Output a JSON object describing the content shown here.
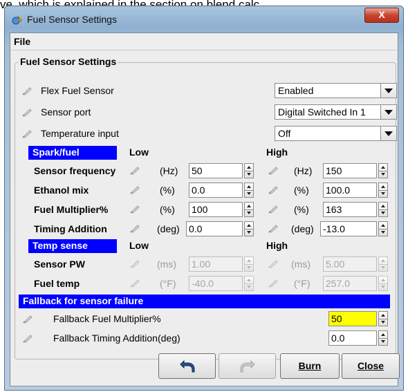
{
  "background_text": "ve, which is explained in the section on blend calc",
  "window": {
    "title": "Fuel Sensor Settings",
    "close_glyph": "X",
    "menu_file": "File"
  },
  "group": {
    "title": "Fuel Sensor Settings"
  },
  "settings": [
    {
      "label": "Flex Fuel Sensor",
      "value": "Enabled"
    },
    {
      "label": "Sensor port",
      "value": "Digital Switched In 1"
    },
    {
      "label": "Temperature input",
      "value": "Off"
    }
  ],
  "spark_fuel": {
    "header": "Spark/fuel",
    "low": "Low",
    "high": "High",
    "rows": [
      {
        "label": "Sensor frequency",
        "low_unit": "(Hz)",
        "low_value": "50",
        "high_unit": "(Hz)",
        "high_value": "150"
      },
      {
        "label": "Ethanol mix",
        "low_unit": "(%)",
        "low_value": "0.0",
        "high_unit": "(%)",
        "high_value": "100.0"
      },
      {
        "label": "Fuel Multiplier%",
        "low_unit": "(%)",
        "low_value": "100",
        "high_unit": "(%)",
        "high_value": "163"
      },
      {
        "label": "Timing Addition",
        "low_unit": "(deg)",
        "low_value": "0.0",
        "high_unit": "(deg)",
        "high_value": "-13.0"
      }
    ]
  },
  "temp_sense": {
    "header": "Temp sense",
    "low": "Low",
    "high": "High",
    "rows": [
      {
        "label": "Sensor PW",
        "low_unit": "(ms)",
        "low_value": "1.00",
        "high_unit": "(ms)",
        "high_value": "5.00"
      },
      {
        "label": "Fuel temp",
        "low_unit": "(°F)",
        "low_value": "-40.0",
        "high_unit": "(°F)",
        "high_value": "257.0"
      }
    ]
  },
  "fallback": {
    "header": "Fallback for sensor failure",
    "rows": [
      {
        "label": "Fallback Fuel Multiplier%",
        "value": "50"
      },
      {
        "label": "Fallback Timing Addition(deg)",
        "value": "0.0"
      }
    ]
  },
  "buttons": {
    "undo": "undo-icon",
    "redo": "redo-icon",
    "burn": "Burn",
    "close": "Close"
  },
  "colors": {
    "section_header": "#0000ff",
    "highlight_field": "#ffff00"
  }
}
